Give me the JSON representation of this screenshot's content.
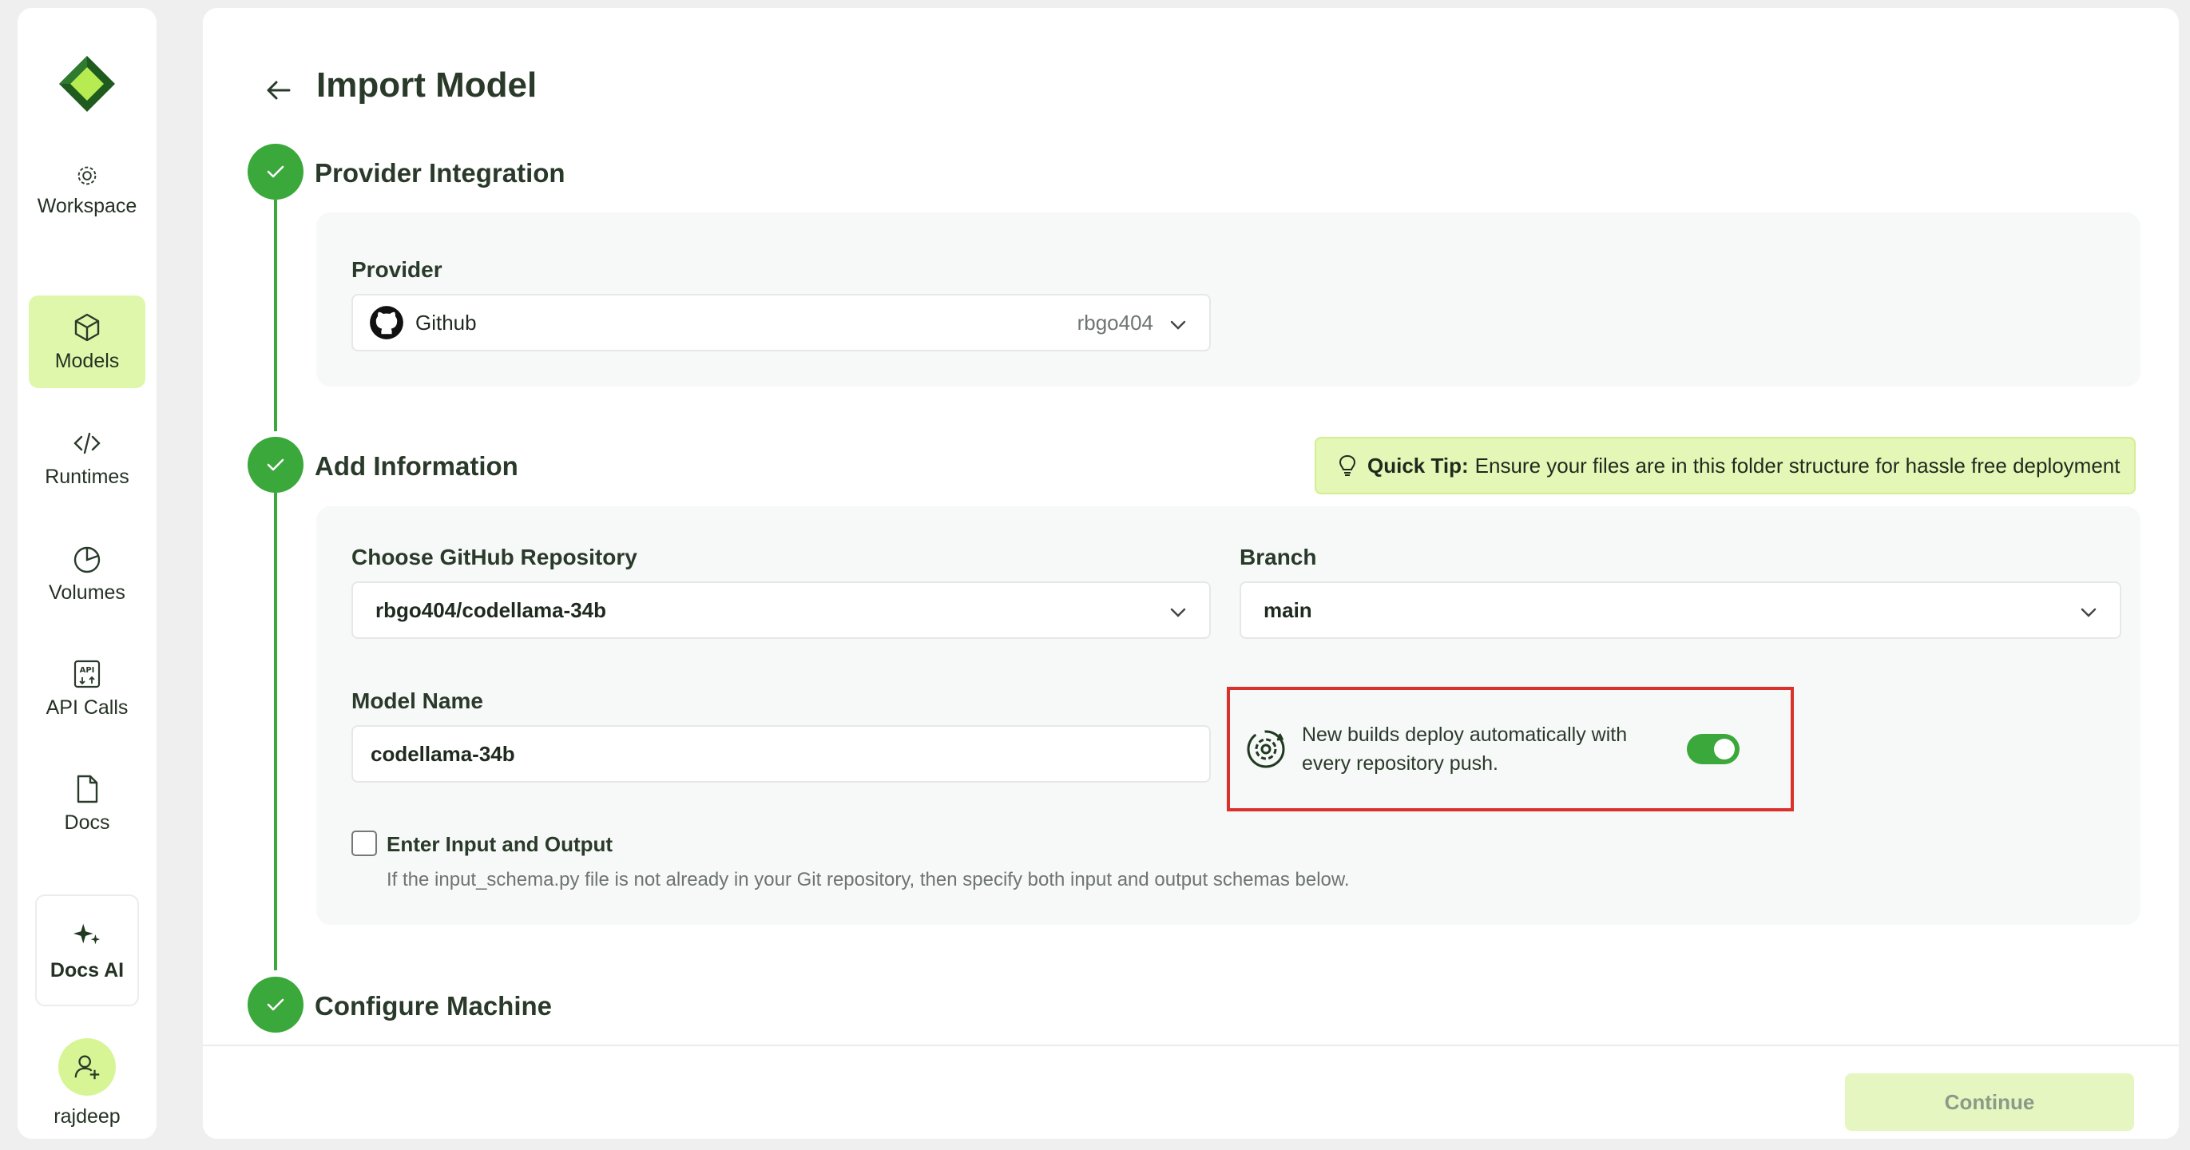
{
  "sidebar": {
    "workspace_label": "Workspace",
    "items": [
      {
        "label": "Models"
      },
      {
        "label": "Runtimes"
      },
      {
        "label": "Volumes"
      },
      {
        "label": "API Calls"
      },
      {
        "label": "Docs"
      }
    ],
    "docs_ai_label": "Docs AI",
    "user_name": "rajdeep"
  },
  "header": {
    "title": "Import Model"
  },
  "steps": {
    "provider": {
      "title": "Provider Integration",
      "field_label": "Provider",
      "provider_name": "Github",
      "account": "rbgo404"
    },
    "info": {
      "title": "Add Information",
      "tip_bold": "Quick Tip:",
      "tip_text": "Ensure your files are in this folder structure for hassle free deployment",
      "repo_label": "Choose GitHub Repository",
      "repo_value": "rbgo404/codellama-34b",
      "branch_label": "Branch",
      "branch_value": "main",
      "model_name_label": "Model Name",
      "model_name_value": "codellama-34b",
      "auto_deploy_text": "New builds deploy automatically with every repository push.",
      "auto_deploy_on": true,
      "io_checkbox_label": "Enter Input and Output",
      "io_help": "If the input_schema.py file is not already in your Git repository, then specify both input and output schemas below."
    },
    "machine": {
      "title": "Configure Machine"
    }
  },
  "footer": {
    "continue_label": "Continue"
  },
  "colors": {
    "accent": "#3aa83a",
    "active_bg": "#dff7ab",
    "highlight_border": "#d9312b"
  }
}
